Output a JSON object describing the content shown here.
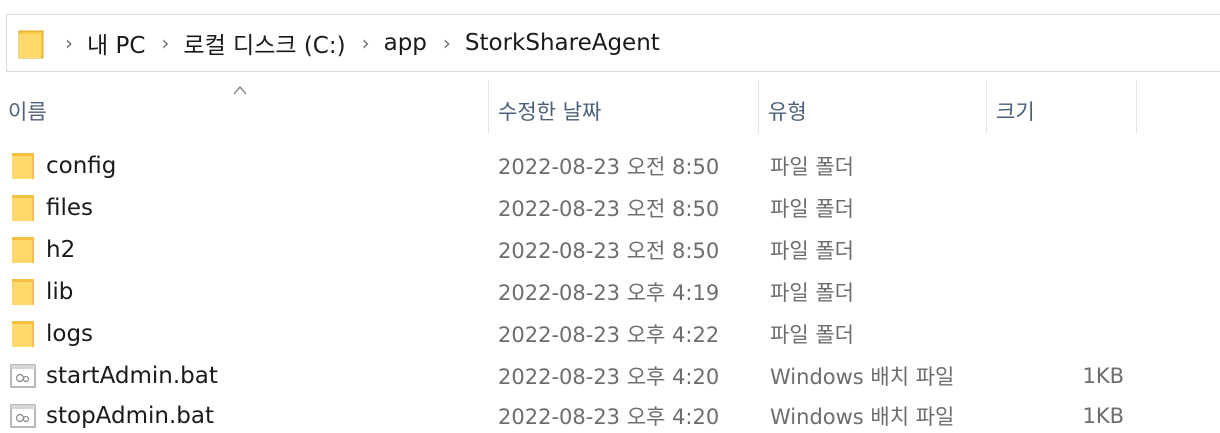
{
  "breadcrumb": {
    "items": [
      "내 PC",
      "로컬 디스크 (C:)",
      "app",
      "StorkShareAgent"
    ]
  },
  "columns": {
    "name": "이름",
    "date": "수정한 날짜",
    "type": "유형",
    "size": "크기"
  },
  "files": [
    {
      "name": "config",
      "date": "2022-08-23 오전 8:50",
      "type": "파일 폴더",
      "size": "",
      "icon": "folder-icon"
    },
    {
      "name": "files",
      "date": "2022-08-23 오전 8:50",
      "type": "파일 폴더",
      "size": "",
      "icon": "folder-icon"
    },
    {
      "name": "h2",
      "date": "2022-08-23 오전 8:50",
      "type": "파일 폴더",
      "size": "",
      "icon": "folder-icon"
    },
    {
      "name": "lib",
      "date": "2022-08-23 오후 4:19",
      "type": "파일 폴더",
      "size": "",
      "icon": "folder-icon"
    },
    {
      "name": "logs",
      "date": "2022-08-23 오후 4:22",
      "type": "파일 폴더",
      "size": "",
      "icon": "folder-icon"
    },
    {
      "name": "startAdmin.bat",
      "date": "2022-08-23 오후 4:20",
      "type": "Windows 배치 파일",
      "size": "1KB",
      "icon": "batch-file-icon"
    },
    {
      "name": "stopAdmin.bat",
      "date": "2022-08-23 오후 4:20",
      "type": "Windows 배치 파일",
      "size": "1KB",
      "icon": "batch-file-icon"
    }
  ],
  "colors": {
    "folder": "#ffd96b",
    "folder_dark": "#e8b84a",
    "header_text": "#4c607a",
    "secondary_text": "#6d6d6d"
  }
}
